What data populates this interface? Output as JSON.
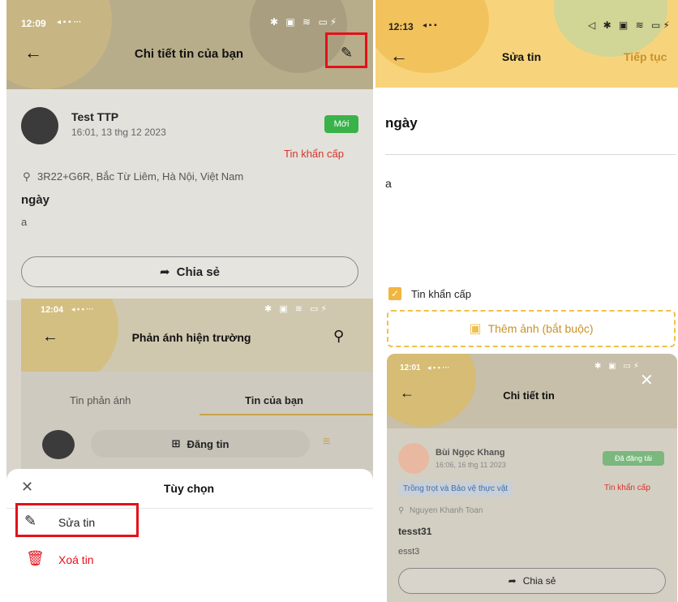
{
  "left": {
    "status": {
      "time": "12:09",
      "extras": "◂ ▪ ▪ ···",
      "icons": "✱ ▣ ≋ ▭⚡"
    },
    "appbar": {
      "title": "Chi tiết tin của bạn"
    },
    "post": {
      "author": "Test TTP",
      "time": "16:01, 13 thg 12 2023",
      "badge": "Mới",
      "urgent": "Tin khẩn cấp",
      "location": "3R22+G6R, Bắc Từ Liêm, Hà Nội, Việt Nam",
      "title": "ngày",
      "body": "a",
      "share": "Chia sẻ"
    },
    "inner": {
      "status_time": "12:04",
      "status_extras": "◂ ▪ ▪ ···",
      "status_icons": "✱ ▣ ≋ ▭⚡",
      "title": "Phản ánh hiện trường",
      "tab_reports": "Tin phản ánh",
      "tab_mine": "Tin của bạn",
      "post_button": "Đăng tin"
    },
    "sheet": {
      "title": "Tùy chọn",
      "edit": "Sửa tin",
      "delete": "Xoá tin"
    }
  },
  "right": {
    "status": {
      "time": "12:13",
      "extras": "◂ ▪ ▪",
      "icons": "◁ ✱ ▣ ≋ ▭⚡"
    },
    "appbar": {
      "title": "Sửa tin",
      "next": "Tiếp tục"
    },
    "form": {
      "title_value": "ngày",
      "body_value": "a",
      "urgent_label": "Tin khẩn cấp",
      "add_image": "Thêm ảnh (bắt buộc)"
    },
    "mini": {
      "status_time": "12:01",
      "status_extras": "◂ ▪ ▪ ···",
      "status_icons": "✱ ▣ ▭⚡",
      "title": "Chi tiết tin",
      "author": "Bùi Ngọc Khang",
      "time": "16:06, 16 thg 11 2023",
      "badge": "Đã đăng tải",
      "category": "Trồng trọt và Bảo vệ thực vật",
      "urgent": "Tin khẩn cấp",
      "location": "Nguyen Khanh Toan",
      "post_title": "tesst31",
      "post_body": "esst3",
      "share": "Chia sẻ"
    }
  },
  "colors": {
    "highlight_red": "#e4101a",
    "accent_yellow": "#f2b53e",
    "badge_green": "#39b24a",
    "urgent_red": "#d9342b"
  }
}
